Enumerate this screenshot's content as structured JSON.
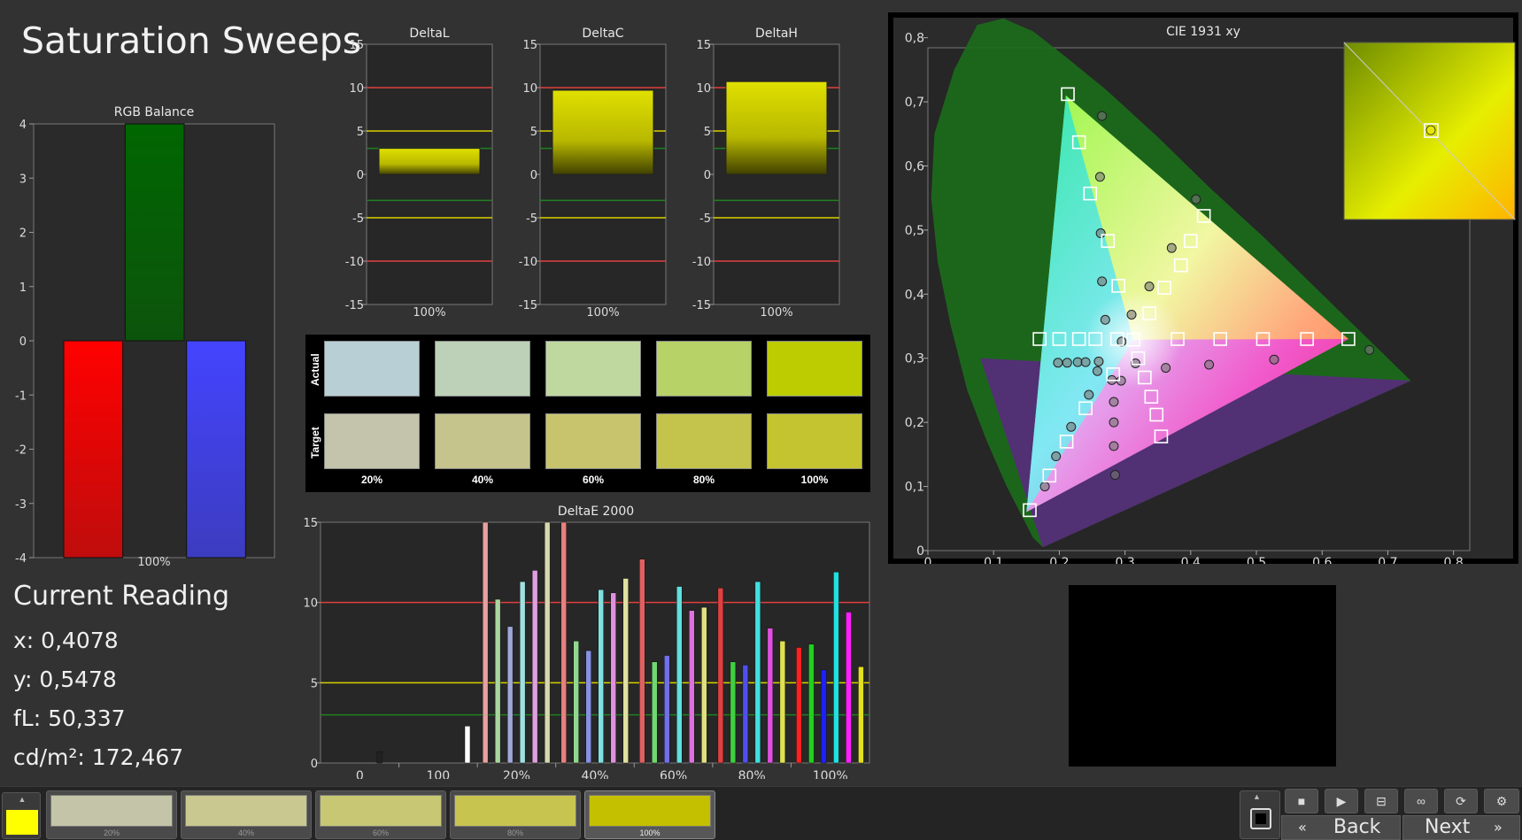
{
  "page": {
    "title": "Saturation Sweeps"
  },
  "rgb_balance": {
    "title": "RGB Balance",
    "yticks": [
      "4",
      "3",
      "2",
      "1",
      "0",
      "-1",
      "-2",
      "-3",
      "-4"
    ],
    "xlabel": "100%",
    "colors": {
      "red": "#ff0000",
      "green": "#006600",
      "blue": "#4444ff"
    }
  },
  "delta_charts": [
    {
      "title": "DeltaL",
      "xlabel": "100%"
    },
    {
      "title": "DeltaC",
      "xlabel": "100%"
    },
    {
      "title": "DeltaH",
      "xlabel": "100%"
    }
  ],
  "delta_yticks": [
    "15",
    "10",
    "5",
    "0",
    "-5",
    "-10",
    "-15"
  ],
  "swatches": {
    "actual_label": "Actual",
    "target_label": "Target",
    "labels": [
      "20%",
      "40%",
      "60%",
      "80%",
      "100%"
    ],
    "actual_colors": [
      "#b9cfd6",
      "#bcd1b8",
      "#bfd89f",
      "#b7d266",
      "#bccc00"
    ],
    "target_colors": [
      "#c4c4ac",
      "#c4c48c",
      "#c8c46e",
      "#c4c44c",
      "#c4c430"
    ]
  },
  "deltae_chart": {
    "title": "DeltaE 2000",
    "yticks": [
      "15",
      "10",
      "5",
      "0"
    ],
    "xticks": [
      "0",
      "100",
      "20%",
      "40%",
      "60%",
      "80%",
      "100%"
    ]
  },
  "cie_chart": {
    "title": "CIE 1931 xy",
    "xticks": [
      "0",
      "0,1",
      "0,2",
      "0,3",
      "0,4",
      "0,5",
      "0,6",
      "0,7",
      "0,8"
    ],
    "yticks": [
      "0",
      "0,1",
      "0,2",
      "0,3",
      "0,4",
      "0,5",
      "0,6",
      "0,7",
      "0,8"
    ]
  },
  "current_reading": {
    "title": "Current Reading",
    "x": "x: 0,4078",
    "y": "y: 0,5478",
    "fl": "fL: 50,337",
    "cdm2": "cd/m²: 172,467"
  },
  "bottom_bar": {
    "current_color": "#ffff00",
    "thumbs": [
      {
        "label": "20%",
        "color": "#c4c4a8"
      },
      {
        "label": "40%",
        "color": "#c8c890"
      },
      {
        "label": "60%",
        "color": "#c8c874"
      },
      {
        "label": "80%",
        "color": "#c8c450"
      },
      {
        "label": "100%",
        "color": "#c4c000"
      }
    ],
    "back_label": "Back",
    "next_label": "Next"
  },
  "chart_data": [
    {
      "type": "bar",
      "title": "RGB Balance",
      "categories": [
        "Red",
        "Green",
        "Blue"
      ],
      "xlabel": "100%",
      "values": [
        -4,
        4,
        -4
      ],
      "ylim": [
        -4,
        4
      ]
    },
    {
      "type": "bar",
      "title": "DeltaL",
      "categories": [
        "100%"
      ],
      "values": [
        3
      ],
      "ylim": [
        -15,
        15
      ]
    },
    {
      "type": "bar",
      "title": "DeltaC",
      "categories": [
        "100%"
      ],
      "values": [
        9.7
      ],
      "ylim": [
        -15,
        15
      ]
    },
    {
      "type": "bar",
      "title": "DeltaH",
      "categories": [
        "100%"
      ],
      "values": [
        10.7
      ],
      "ylim": [
        -15,
        15
      ]
    },
    {
      "type": "bar",
      "title": "DeltaE 2000",
      "categories": [
        "0",
        "100",
        "20%",
        "40%",
        "60%",
        "80%",
        "100%"
      ],
      "ylim": [
        0,
        15
      ],
      "groups": [
        {
          "category": "0",
          "bars": [
            {
              "value": 0.7,
              "color": "#222222"
            }
          ]
        },
        {
          "category": "100",
          "bars": [
            {
              "value": 2.3,
              "color": "#ffffff"
            }
          ]
        },
        {
          "category": "20%",
          "bars": [
            {
              "value": 15,
              "color": "#e8a0a0"
            },
            {
              "value": 10.2,
              "color": "#a8d8a0"
            },
            {
              "value": 8.5,
              "color": "#a0a8d8"
            },
            {
              "value": 11.3,
              "color": "#a0e0e0"
            },
            {
              "value": 12.0,
              "color": "#e0a0e0"
            },
            {
              "value": 15,
              "color": "#d8d8b0"
            }
          ]
        },
        {
          "category": "40%",
          "bars": [
            {
              "value": 15,
              "color": "#e88080"
            },
            {
              "value": 7.6,
              "color": "#90d890"
            },
            {
              "value": 7.0,
              "color": "#8890e0"
            },
            {
              "value": 10.8,
              "color": "#80e0e0"
            },
            {
              "value": 10.6,
              "color": "#e090e0"
            },
            {
              "value": 11.5,
              "color": "#e0e0a0"
            }
          ]
        },
        {
          "category": "60%",
          "bars": [
            {
              "value": 12.7,
              "color": "#e06060"
            },
            {
              "value": 6.3,
              "color": "#70d870"
            },
            {
              "value": 6.7,
              "color": "#7070e8"
            },
            {
              "value": 11.0,
              "color": "#60e0e0"
            },
            {
              "value": 9.5,
              "color": "#e070e0"
            },
            {
              "value": 9.7,
              "color": "#e0e080"
            }
          ]
        },
        {
          "category": "80%",
          "bars": [
            {
              "value": 10.9,
              "color": "#e04040"
            },
            {
              "value": 6.3,
              "color": "#40d040"
            },
            {
              "value": 6.1,
              "color": "#5050f0"
            },
            {
              "value": 11.3,
              "color": "#40e0e0"
            },
            {
              "value": 8.4,
              "color": "#e050e0"
            },
            {
              "value": 7.6,
              "color": "#e0e050"
            }
          ]
        },
        {
          "category": "100%",
          "bars": [
            {
              "value": 7.2,
              "color": "#ff2020"
            },
            {
              "value": 7.4,
              "color": "#20d020"
            },
            {
              "value": 5.8,
              "color": "#2020ff"
            },
            {
              "value": 11.9,
              "color": "#20e0e0"
            },
            {
              "value": 9.4,
              "color": "#ff20ff"
            },
            {
              "value": 6.0,
              "color": "#e0e020"
            }
          ]
        }
      ]
    },
    {
      "type": "scatter",
      "title": "CIE 1931 xy",
      "xlim": [
        0,
        0.8
      ],
      "ylim": [
        0,
        0.8
      ],
      "series": [
        {
          "name": "target",
          "points": [
            [
              0.213,
              0.712
            ],
            [
              0.23,
              0.637
            ],
            [
              0.247,
              0.557
            ],
            [
              0.274,
              0.483
            ],
            [
              0.29,
              0.413
            ],
            [
              0.155,
              0.063
            ],
            [
              0.185,
              0.117
            ],
            [
              0.211,
              0.17
            ],
            [
              0.24,
              0.222
            ],
            [
              0.282,
              0.275
            ],
            [
              0.64,
              0.33
            ],
            [
              0.577,
              0.33
            ],
            [
              0.51,
              0.33
            ],
            [
              0.445,
              0.33
            ],
            [
              0.38,
              0.33
            ],
            [
              0.17,
              0.33
            ],
            [
              0.2,
              0.33
            ],
            [
              0.23,
              0.33
            ],
            [
              0.255,
              0.33
            ],
            [
              0.288,
              0.33
            ],
            [
              0.3127,
              0.329
            ],
            [
              0.42,
              0.522
            ],
            [
              0.4,
              0.483
            ],
            [
              0.385,
              0.445
            ],
            [
              0.36,
              0.41
            ],
            [
              0.337,
              0.37
            ],
            [
              0.355,
              0.178
            ],
            [
              0.348,
              0.212
            ],
            [
              0.34,
              0.24
            ],
            [
              0.33,
              0.27
            ],
            [
              0.32,
              0.3
            ]
          ]
        },
        {
          "name": "measured",
          "points": [
            [
              0.265,
              0.678
            ],
            [
              0.262,
              0.583
            ],
            [
              0.263,
              0.495
            ],
            [
              0.265,
              0.42
            ],
            [
              0.27,
              0.36
            ],
            [
              0.178,
              0.1
            ],
            [
              0.195,
              0.147
            ],
            [
              0.218,
              0.193
            ],
            [
              0.245,
              0.243
            ],
            [
              0.28,
              0.266
            ],
            [
              0.672,
              0.313
            ],
            [
              0.527,
              0.298
            ],
            [
              0.428,
              0.29
            ],
            [
              0.362,
              0.285
            ],
            [
              0.316,
              0.292
            ],
            [
              0.198,
              0.293
            ],
            [
              0.212,
              0.293
            ],
            [
              0.228,
              0.294
            ],
            [
              0.24,
              0.294
            ],
            [
              0.26,
              0.295
            ],
            [
              0.408,
              0.548
            ],
            [
              0.371,
              0.472
            ],
            [
              0.337,
              0.412
            ],
            [
              0.31,
              0.368
            ],
            [
              0.295,
              0.326
            ],
            [
              0.285,
              0.118
            ],
            [
              0.283,
              0.163
            ],
            [
              0.283,
              0.2
            ],
            [
              0.283,
              0.232
            ],
            [
              0.294,
              0.265
            ],
            [
              0.258,
              0.28
            ]
          ]
        }
      ]
    }
  ]
}
